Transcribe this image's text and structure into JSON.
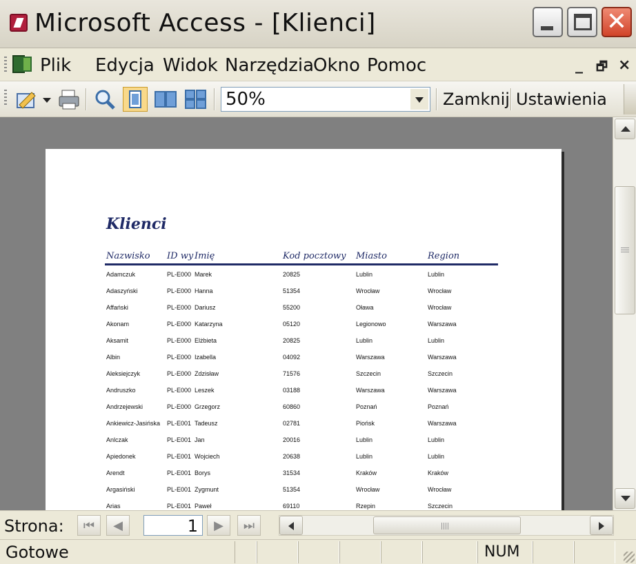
{
  "window": {
    "title": "Microsoft Access - [Klienci]"
  },
  "menu": {
    "items": [
      "Plik",
      "Edycja",
      "Widok",
      "Narzędzia",
      "Okno",
      "Pomoc"
    ],
    "doc_minimize": "_",
    "doc_restore": "🗗",
    "doc_close": "×"
  },
  "toolbar": {
    "zoom_value": "50%",
    "close_label": "Zamknij",
    "settings_label": "Ustawienia"
  },
  "report": {
    "title": "Klienci",
    "columns": [
      "Nazwisko",
      "ID wy",
      "Imię",
      "Kod pocztowy",
      "Miasto",
      "Region"
    ],
    "rows": [
      [
        "Adamczuk",
        "PL-E000",
        "Marek",
        "20825",
        "Lublin",
        "Lublin"
      ],
      [
        "Adaszyński",
        "PL-E000",
        "Hanna",
        "51354",
        "Wrocław",
        "Wrocław"
      ],
      [
        "Affański",
        "PL-E000",
        "Dariusz",
        "55200",
        "Oława",
        "Wrocław"
      ],
      [
        "Akonam",
        "PL-E000",
        "Katarzyna",
        "05120",
        "Legionowo",
        "Warszawa"
      ],
      [
        "Aksamit",
        "PL-E000",
        "Elżbieta",
        "20825",
        "Lublin",
        "Lublin"
      ],
      [
        "Albin",
        "PL-E000",
        "Izabella",
        "04092",
        "Warszawa",
        "Warszawa"
      ],
      [
        "Aleksiejczyk",
        "PL-E000",
        "Zdzisław",
        "71576",
        "Szczecin",
        "Szczecin"
      ],
      [
        "Andruszko",
        "PL-E000",
        "Leszek",
        "03188",
        "Warszawa",
        "Warszawa"
      ],
      [
        "Andrzejewski",
        "PL-E000",
        "Grzegorz",
        "60860",
        "Poznań",
        "Poznań"
      ],
      [
        "Ankiewicz-Jasińska",
        "PL-E001",
        "Tadeusz",
        "02781",
        "Piońsk",
        "Warszawa"
      ],
      [
        "Anlczak",
        "PL-E001",
        "Jan",
        "20016",
        "Lublin",
        "Lublin"
      ],
      [
        "Apiedonek",
        "PL-E001",
        "Wojciech",
        "20638",
        "Lublin",
        "Lublin"
      ],
      [
        "Arendt",
        "PL-E001",
        "Borys",
        "31534",
        "Kraków",
        "Kraków"
      ],
      [
        "Argasiński",
        "PL-E001",
        "Zygmunt",
        "51354",
        "Wrocław",
        "Wrocław"
      ],
      [
        "Arias",
        "PL-E001",
        "Paweł",
        "69110",
        "Rzepin",
        "Szczecin"
      ]
    ]
  },
  "navigation": {
    "label": "Strona:",
    "current_page": "1"
  },
  "status": {
    "text": "Gotowe",
    "num": "NUM"
  },
  "colors": {
    "report_title": "#1f2a66",
    "workspace": "#808080",
    "chrome": "#ECE9D8"
  }
}
